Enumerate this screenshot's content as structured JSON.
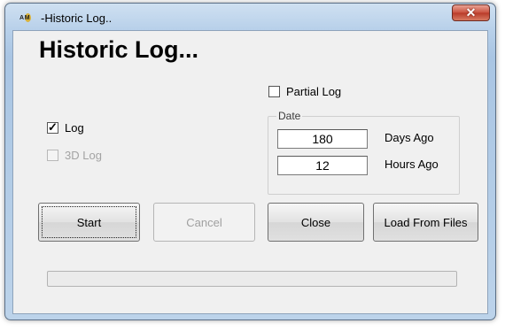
{
  "window": {
    "title": "-Historic Log..",
    "icon": "apm-logo-icon",
    "close_glyph": "✕",
    "brand_color": "#c9503e"
  },
  "heading": "Historic Log...",
  "options": {
    "log": {
      "label": "Log",
      "checked": true,
      "enabled": true
    },
    "log3d": {
      "label": "3D Log",
      "checked": false,
      "enabled": false
    },
    "partial_log": {
      "label": "Partial Log",
      "checked": false,
      "enabled": true
    }
  },
  "date_group": {
    "label": "Date",
    "days_value": "180",
    "days_label": "Days Ago",
    "hours_value": "12",
    "hours_label": "Hours Ago"
  },
  "buttons": {
    "start": "Start",
    "cancel": "Cancel",
    "close": "Close",
    "load_from_files": "Load From Files"
  },
  "progress": {
    "value": 0
  }
}
